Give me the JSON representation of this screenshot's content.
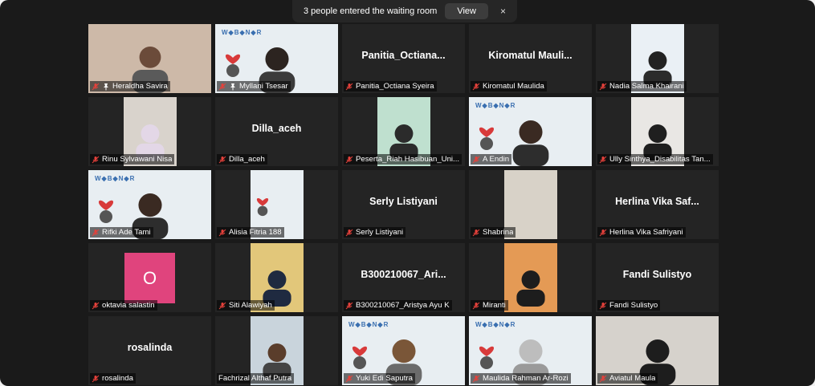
{
  "notification": {
    "message": "3 people entered the waiting room",
    "view_label": "View",
    "close_label": "×"
  },
  "participants": [
    {
      "name": "Heraldha Savira",
      "pinned": true
    },
    {
      "name": "Myllani Tsesar",
      "pinned": true,
      "active": true
    },
    {
      "name": "Panitia_Octiana Syeira",
      "display": "Panitia_Octiana..."
    },
    {
      "name": "Kiromatul Maulida",
      "display": "Kiromatul  Mauli..."
    },
    {
      "name": "Nadia Salma Khairani"
    },
    {
      "name": "Rinu Sylvawani Nisa"
    },
    {
      "name": "Dilla_aceh",
      "display": "Dilla_aceh"
    },
    {
      "name": "Peserta_Riah Hasibuan_Uni..."
    },
    {
      "name": "A Endin"
    },
    {
      "name": "Ully Sinthya_Disabilitas Tan..."
    },
    {
      "name": "Rifki Ade Tami"
    },
    {
      "name": "Alisia Fitria 188"
    },
    {
      "name": "Serly Listiyani",
      "display": "Serly Listiyani"
    },
    {
      "name": "Shabrina"
    },
    {
      "name": "Herlina Vika Safriyani",
      "display": "Herlina  Vika  Saf..."
    },
    {
      "name": "oktavia salastin",
      "avatar_letter": "O"
    },
    {
      "name": "Siti Alawiyah"
    },
    {
      "name": "B300210067_Aristya Ayu K",
      "display": "B300210067_Ari..."
    },
    {
      "name": "Miranti"
    },
    {
      "name": "Fandi Sulistyo",
      "display": "Fandi Sulistyo"
    },
    {
      "name": "rosalinda",
      "display": "rosalinda"
    },
    {
      "name": "Fachrizal Althaf Putra"
    },
    {
      "name": "Yuki Edi Saputra"
    },
    {
      "name": "Maulida Rahman Ar-Rozi"
    },
    {
      "name": "Aviatul Maula"
    }
  ],
  "colors": {
    "background": "#1a1a1a",
    "tile": "#242424",
    "active_border": "#e6e28a",
    "muted_mic": "#e5413b",
    "avatar": "#e0447d"
  }
}
